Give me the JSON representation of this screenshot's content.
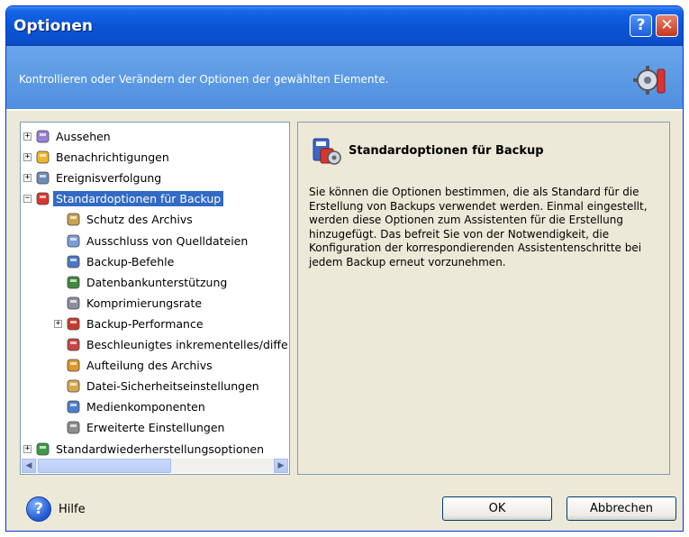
{
  "window": {
    "title": "Optionen",
    "help_glyph": "?",
    "close_glyph": "✕"
  },
  "header": {
    "text": "Kontrollieren oder Verändern der Optionen der gewählten Elemente."
  },
  "tree": {
    "items": [
      {
        "label": "Aussehen",
        "icon": "appearance-icon",
        "expander": "+"
      },
      {
        "label": "Benachrichtigungen",
        "icon": "notification-icon",
        "expander": "+"
      },
      {
        "label": "Ereignisverfolgung",
        "icon": "event-log-icon",
        "expander": "+"
      },
      {
        "label": "Standardoptionen für Backup",
        "icon": "backup-options-icon",
        "expander": "−",
        "selected": true
      },
      {
        "label": "Schutz des Archivs",
        "icon": "lock-icon"
      },
      {
        "label": "Ausschluss von Quelldateien",
        "icon": "exclude-files-icon"
      },
      {
        "label": "Backup-Befehle",
        "icon": "commands-icon"
      },
      {
        "label": "Datenbankunterstützung",
        "icon": "shield-icon"
      },
      {
        "label": "Komprimierungsrate",
        "icon": "compression-icon"
      },
      {
        "label": "Backup-Performance",
        "icon": "performance-icon",
        "expander": "+"
      },
      {
        "label": "Beschleunigtes inkrementelles/diffe",
        "icon": "incremental-icon"
      },
      {
        "label": "Aufteilung des Archivs",
        "icon": "split-archive-icon"
      },
      {
        "label": "Datei-Sicherheitseinstellungen",
        "icon": "file-security-icon"
      },
      {
        "label": "Medienkomponenten",
        "icon": "media-icon"
      },
      {
        "label": "Erweiterte Einstellungen",
        "icon": "advanced-settings-icon"
      },
      {
        "label": "Standardwiederherstellungsoptionen",
        "icon": "restore-options-icon",
        "expander": "+"
      }
    ],
    "scroll_left_glyph": "◀",
    "scroll_right_glyph": "▶"
  },
  "detail": {
    "title": "Standardoptionen für Backup",
    "description": "Sie können die Optionen bestimmen, die als Standard für die Erstellung von Backups verwendet werden. Einmal eingestellt, werden diese Optionen zum Assistenten für die Erstellung hinzugefügt. Das befreit Sie von der Notwendigkeit, die Konfiguration der korrespondierenden Assistentenschritte bei jedem Backup erneut vorzunehmen."
  },
  "footer": {
    "help_label": "Hilfe",
    "help_glyph": "?",
    "ok_label": "OK",
    "cancel_label": "Abbrechen"
  },
  "colors": {
    "titlebar": "#0A55D6",
    "header_band": "#5599E6",
    "selection": "#316AC5",
    "dialog_bg": "#ECE9D8"
  }
}
